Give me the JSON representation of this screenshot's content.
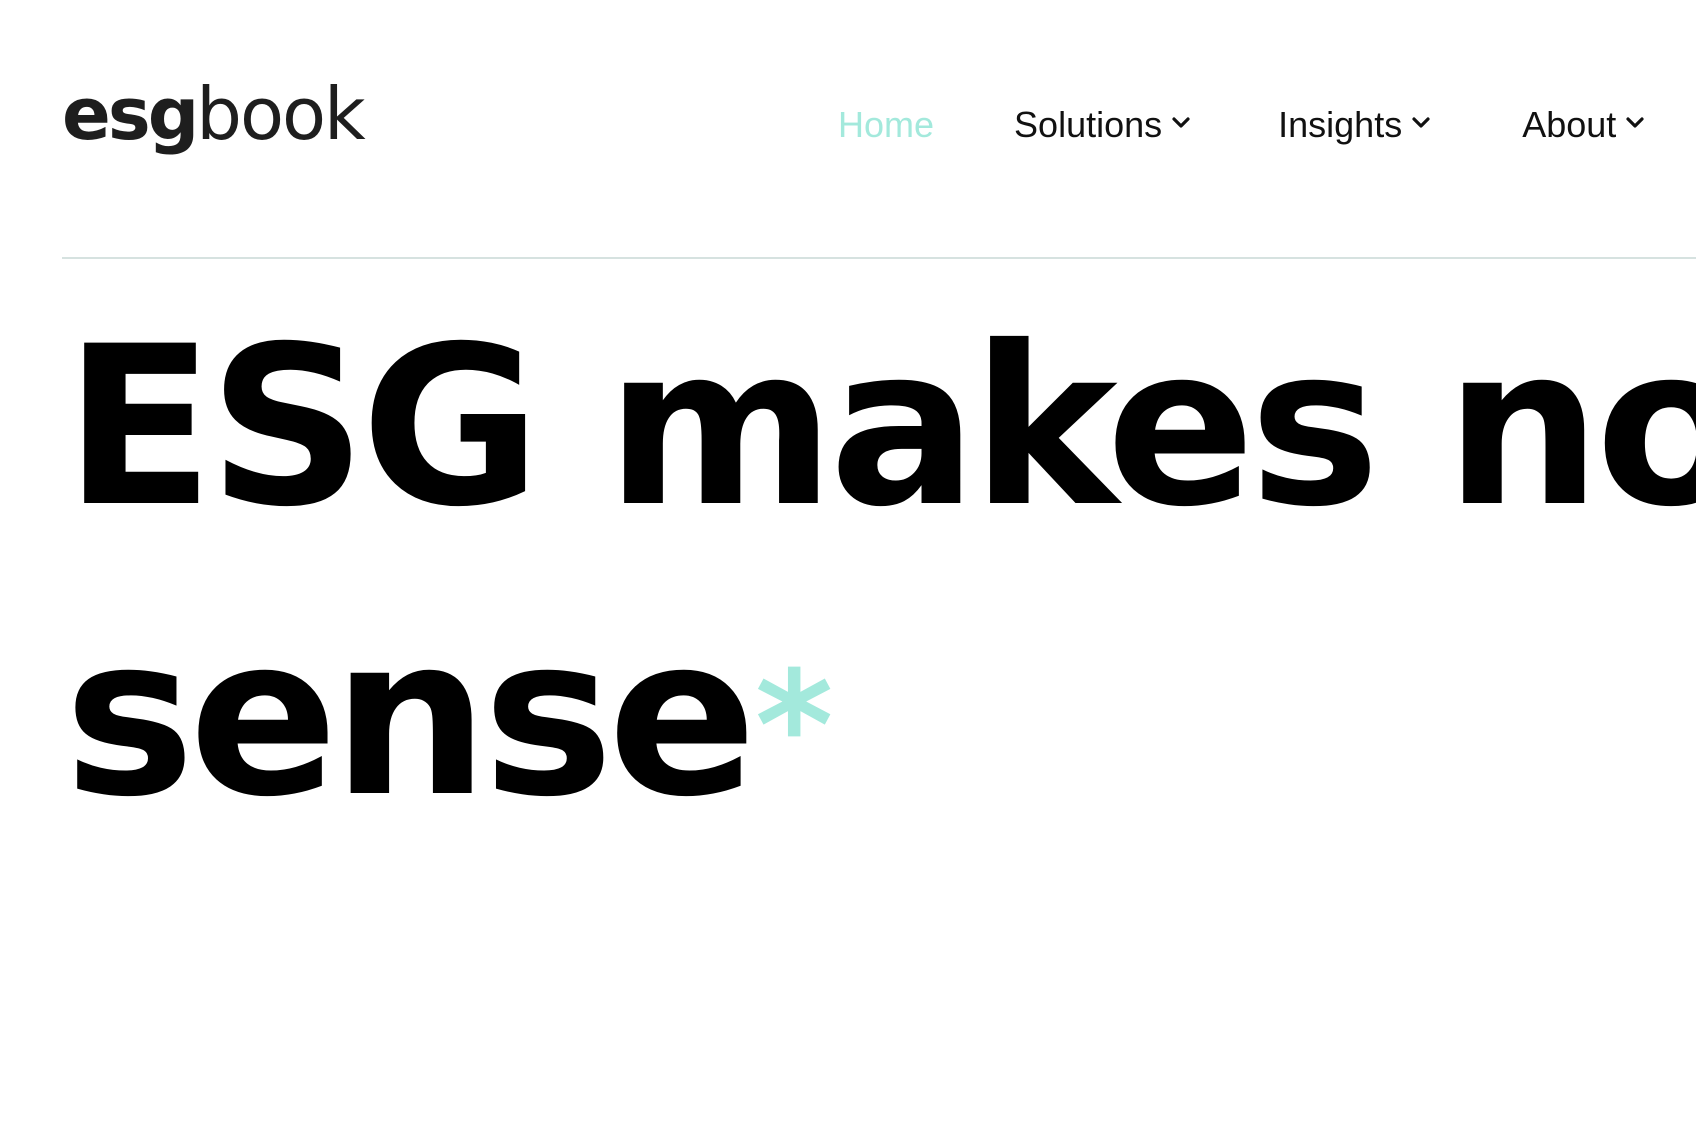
{
  "logo": {
    "bold_part": "esg",
    "light_part": "book"
  },
  "nav": {
    "items": [
      {
        "label": "Home",
        "active": true,
        "has_dropdown": false
      },
      {
        "label": "Solutions",
        "active": false,
        "has_dropdown": true
      },
      {
        "label": "Insights",
        "active": false,
        "has_dropdown": true
      },
      {
        "label": "About",
        "active": false,
        "has_dropdown": true
      }
    ]
  },
  "hero": {
    "line1": "ESG makes no",
    "line2": "sense",
    "asterisk": "*"
  },
  "colors": {
    "accent": "#a3e9dc",
    "text": "#000000",
    "divider": "#d6e2e0"
  }
}
